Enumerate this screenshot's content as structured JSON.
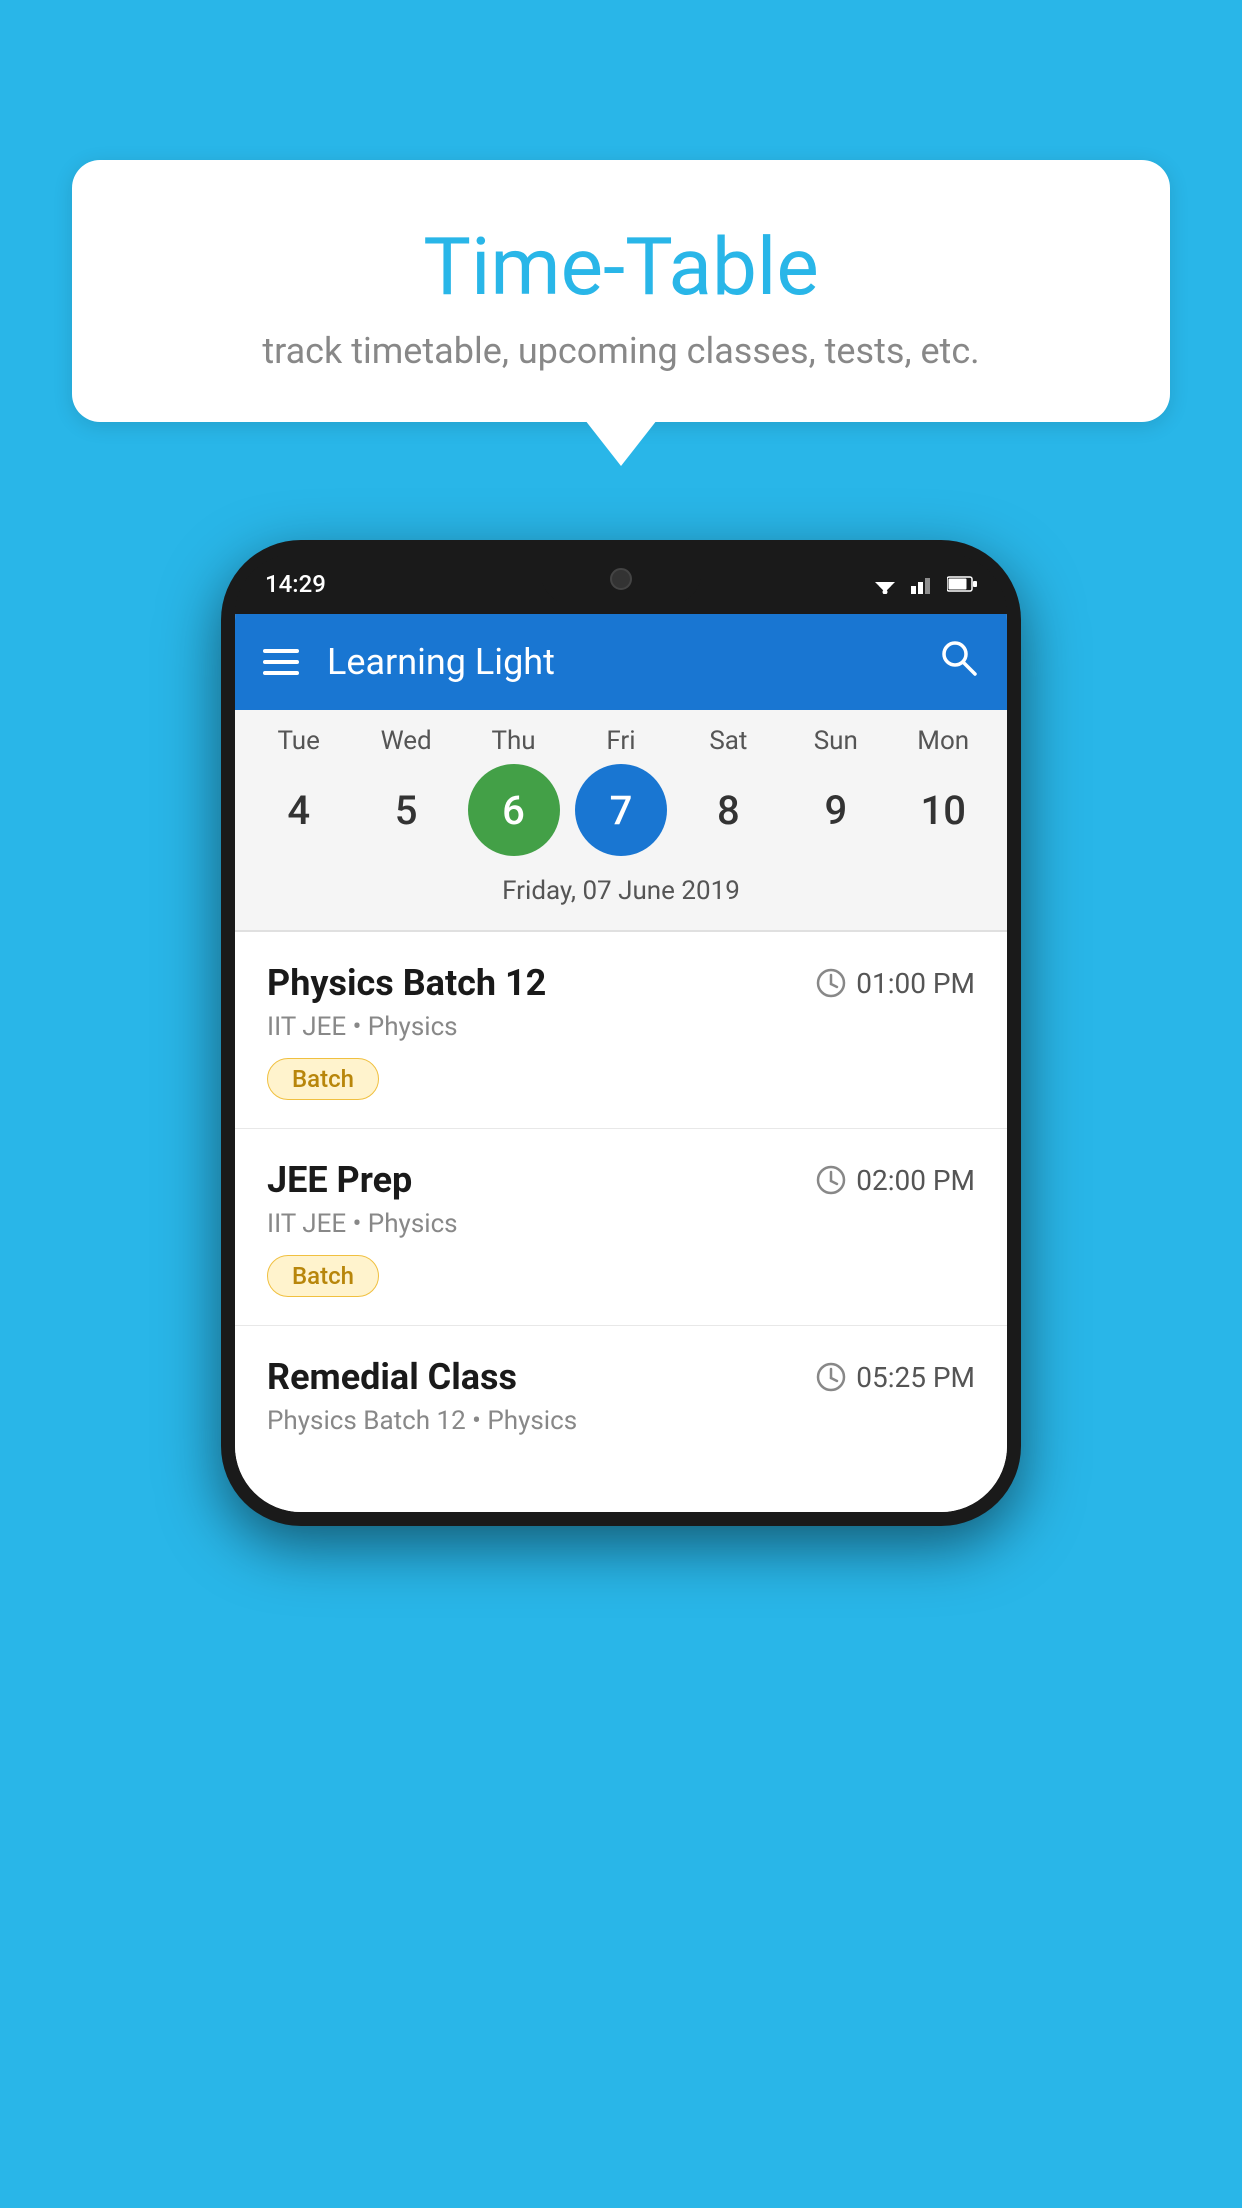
{
  "background_color": "#29b6e8",
  "bubble": {
    "title": "Time-Table",
    "subtitle": "track timetable, upcoming classes, tests, etc."
  },
  "phone": {
    "status_bar": {
      "time": "14:29"
    },
    "app_bar": {
      "title": "Learning Light"
    },
    "calendar": {
      "days": [
        {
          "label": "Tue",
          "number": "4",
          "state": "normal"
        },
        {
          "label": "Wed",
          "number": "5",
          "state": "normal"
        },
        {
          "label": "Thu",
          "number": "6",
          "state": "today"
        },
        {
          "label": "Fri",
          "number": "7",
          "state": "selected"
        },
        {
          "label": "Sat",
          "number": "8",
          "state": "normal"
        },
        {
          "label": "Sun",
          "number": "9",
          "state": "normal"
        },
        {
          "label": "Mon",
          "number": "10",
          "state": "normal"
        }
      ],
      "selected_date_label": "Friday, 07 June 2019"
    },
    "classes": [
      {
        "name": "Physics Batch 12",
        "time": "01:00 PM",
        "meta": "IIT JEE • Physics",
        "badge": "Batch"
      },
      {
        "name": "JEE Prep",
        "time": "02:00 PM",
        "meta": "IIT JEE • Physics",
        "badge": "Batch"
      },
      {
        "name": "Remedial Class",
        "time": "05:25 PM",
        "meta": "Physics Batch 12 • Physics",
        "badge": null
      }
    ]
  }
}
